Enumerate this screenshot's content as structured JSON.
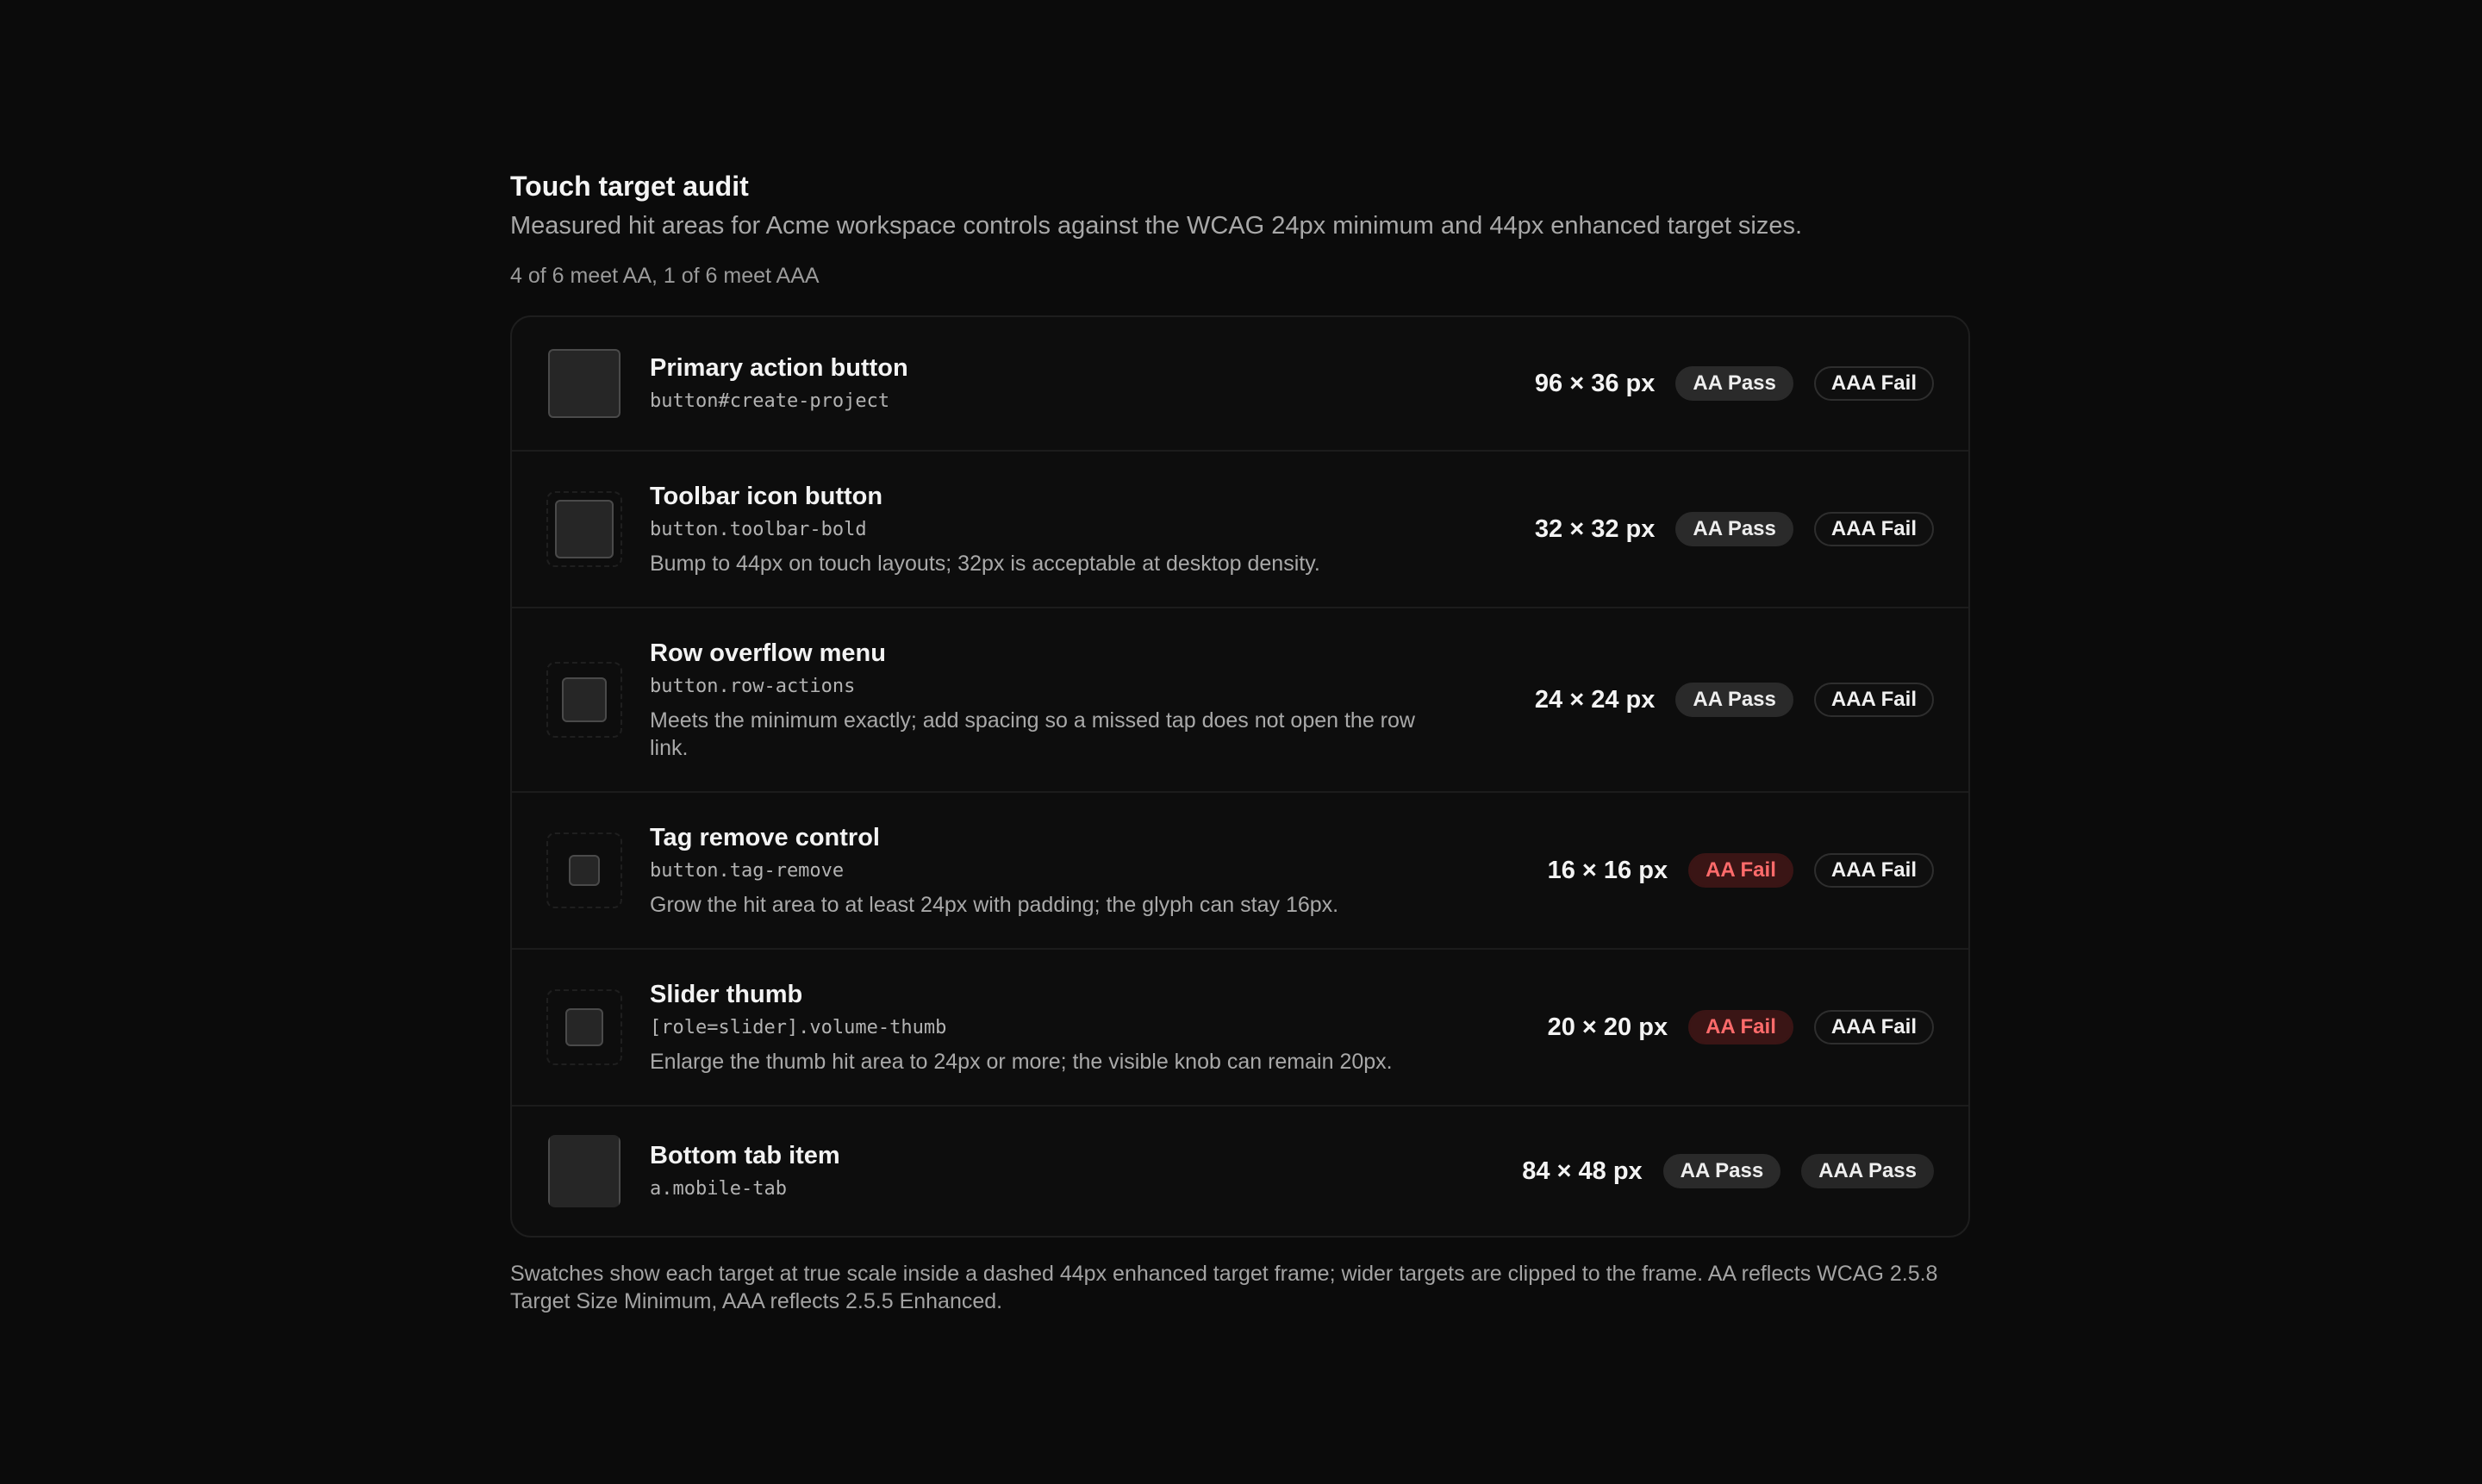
{
  "header": {
    "title": "Touch target audit",
    "subtitle": "Measured hit areas for Acme workspace controls against the WCAG 24px minimum and 44px enhanced target sizes.",
    "summary": "4 of 6 meet AA, 1 of 6 meet AAA"
  },
  "colors": {
    "background": "#0b0b0b",
    "pass_badge_bg": "#2a2a2a",
    "fail_badge_bg": "#3a1515",
    "fail_badge_text": "#ff6b6b"
  },
  "targets": [
    {
      "name": "Primary action button",
      "selector": "button#create-project",
      "note": "",
      "size_label": "96 × 36 px",
      "aa": "AA Pass",
      "aaa": "AAA Fail"
    },
    {
      "name": "Toolbar icon button",
      "selector": "button.toolbar-bold",
      "note": "Bump to 44px on touch layouts; 32px is acceptable at desktop density.",
      "size_label": "32 × 32 px",
      "aa": "AA Pass",
      "aaa": "AAA Fail"
    },
    {
      "name": "Row overflow menu",
      "selector": "button.row-actions",
      "note": "Meets the minimum exactly; add spacing so a missed tap does not open the row link.",
      "size_label": "24 × 24 px",
      "aa": "AA Pass",
      "aaa": "AAA Fail"
    },
    {
      "name": "Tag remove control",
      "selector": "button.tag-remove",
      "note": "Grow the hit area to at least 24px with padding; the glyph can stay 16px.",
      "size_label": "16 × 16 px",
      "aa": "AA Fail",
      "aaa": "AAA Fail"
    },
    {
      "name": "Slider thumb",
      "selector": "[role=slider].volume-thumb",
      "note": "Enlarge the thumb hit area to 24px or more; the visible knob can remain 20px.",
      "size_label": "20 × 20 px",
      "aa": "AA Fail",
      "aaa": "AAA Fail"
    },
    {
      "name": "Bottom tab item",
      "selector": "a.mobile-tab",
      "note": "",
      "size_label": "84 × 48 px",
      "aa": "AA Pass",
      "aaa": "AAA Pass"
    }
  ],
  "footer": {
    "text": "Swatches show each target at true scale inside a dashed 44px enhanced target frame; wider targets are clipped to the frame. AA reflects WCAG 2.5.8 Target Size Minimum, AAA reflects 2.5.5 Enhanced."
  }
}
